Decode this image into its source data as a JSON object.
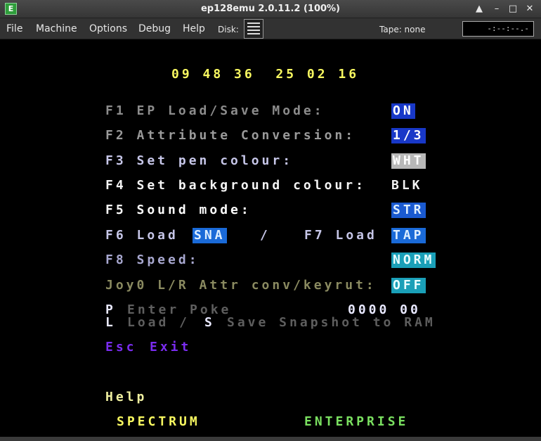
{
  "window": {
    "icon_letter": "E",
    "title": "ep128emu 2.0.11.2 (100%)",
    "buttons": {
      "up": "▲",
      "minimize": "–",
      "maximize": "□",
      "close": "✕"
    }
  },
  "menu": {
    "items": [
      "File",
      "Machine",
      "Options",
      "Debug",
      "Help"
    ],
    "disk_label": "Disk:",
    "tape_label": "Tape: none",
    "tape_counter": "-:--:--.-"
  },
  "screen": {
    "clock": "09 48 36  25 02 16",
    "f1": {
      "label": "F1 EP Load/Save Mode:",
      "value": "ON"
    },
    "f2": {
      "label": "F2 Attribute Conversion:",
      "value": "1/3"
    },
    "f3": {
      "label": "F3 Set pen colour:",
      "value": "WHT"
    },
    "f4": {
      "label": "F4 Set background colour:",
      "value": "BLK"
    },
    "f5": {
      "label": "F5 Sound mode:",
      "value": "STR"
    },
    "f6": {
      "label": "F6 Load",
      "value": "SNA",
      "sep": "/"
    },
    "f7": {
      "label": "F7 Load",
      "value": "TAP"
    },
    "f8": {
      "label": "F8 Speed:",
      "value": "NORM"
    },
    "joy": {
      "label": "Joy0 L/R Attr conv/keyrut:",
      "value": "OFF"
    },
    "poke": {
      "key": "P",
      "label": "Enter Poke",
      "value": "0000 00"
    },
    "snapshot": {
      "key": "L",
      "label1": "Load /",
      "key2": "S",
      "label2": "Save Snapshot to RAM"
    },
    "esc": {
      "key": "Esc",
      "label": "Exit"
    },
    "help": "Help",
    "spectrum": "SPECTRUM",
    "enterprise": "ENTERPRISE"
  },
  "colors": {
    "yellow": "#f8f860",
    "grey_text": "#8c8c8c",
    "dim_text": "#6e6e6e",
    "white_text": "#f4f4f4",
    "lavender": "#c6c6e8",
    "olive": "#8a8a60",
    "purple": "#7a2cf0",
    "green": "#7ae060",
    "blue_box": "#1838c8"
  }
}
